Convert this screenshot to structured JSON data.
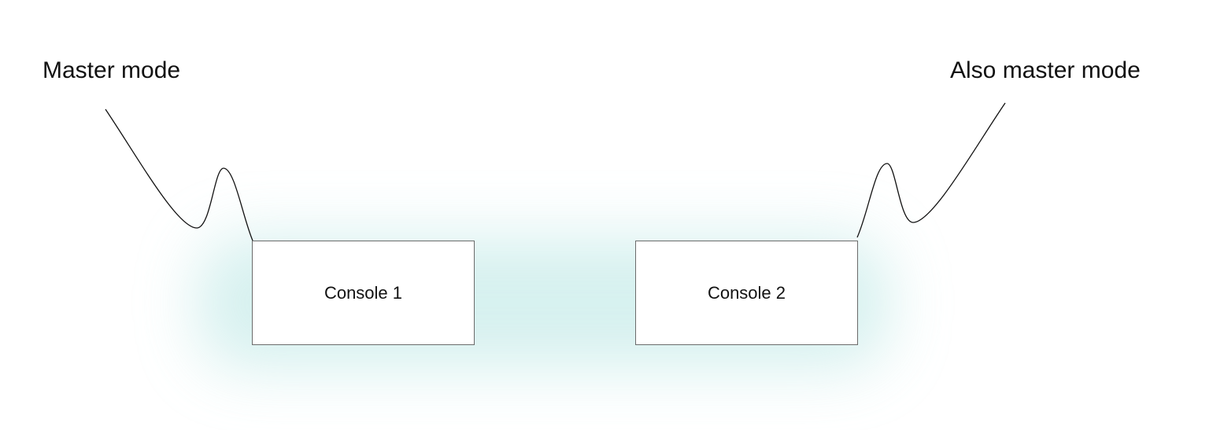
{
  "labels": {
    "left": "Master mode",
    "right": "Also master mode"
  },
  "consoles": [
    {
      "label": "Console 1"
    },
    {
      "label": "Console 2"
    }
  ],
  "colors": {
    "glow": "#bfe9e6",
    "box_border": "#6b6b6b",
    "line": "#111111",
    "text": "#111111"
  }
}
